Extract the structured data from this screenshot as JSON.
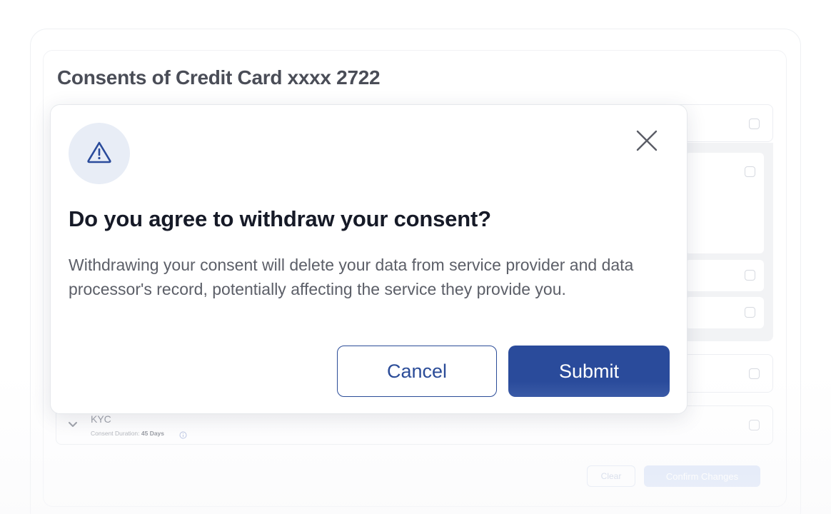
{
  "page": {
    "title": "Consents of Credit Card xxxx 2722"
  },
  "consent_list": {
    "kyc": {
      "label": "KYC",
      "duration_prefix": "Consent Duration: ",
      "duration_value": "45 Days"
    },
    "actions": {
      "clear_label": "Clear",
      "confirm_label": "Confirm Changes"
    }
  },
  "modal": {
    "icon": "warning-triangle-icon",
    "title": "Do you agree to withdraw your consent?",
    "body": "Withdrawing your consent will delete your data from service provider and data processor's record, potentially affecting the service they provide you.",
    "cancel_label": "Cancel",
    "submit_label": "Submit",
    "close_icon": "close-icon"
  },
  "colors": {
    "primary": "#2a4b9b",
    "icon_bg": "#e8edf6",
    "title_text": "#161a27",
    "body_text": "#5c5f68"
  }
}
